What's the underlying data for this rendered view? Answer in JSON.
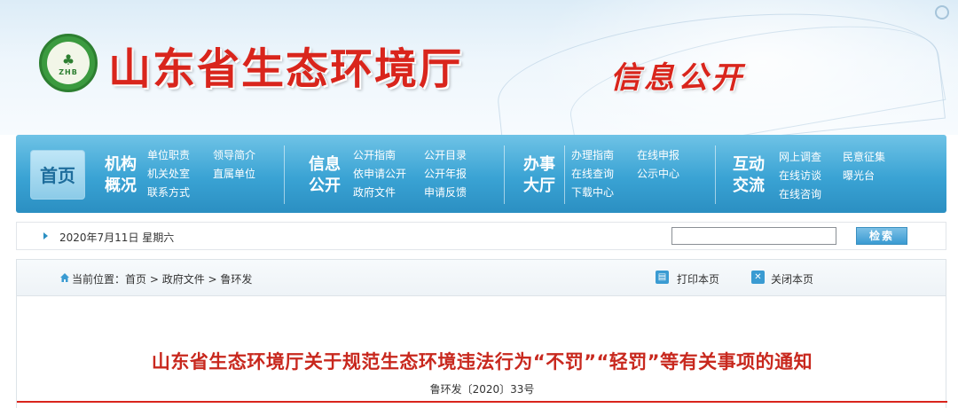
{
  "header": {
    "site_title": "山东省生态环境厅",
    "section_title": "信息公开",
    "logo_text": "ZHB"
  },
  "nav": {
    "home_label": "首页",
    "groups": [
      {
        "category": "机构概况",
        "cat_line1": "机构",
        "cat_line2": "概况",
        "links": [
          "单位职责",
          "领导简介",
          "机关处室",
          "直属单位",
          "联系方式"
        ]
      },
      {
        "category": "信息公开",
        "cat_line1": "信息",
        "cat_line2": "公开",
        "links": [
          "公开指南",
          "公开目录",
          "依申请公开",
          "公开年报",
          "政府文件",
          "申请反馈"
        ]
      },
      {
        "category": "办事大厅",
        "cat_line1": "办事",
        "cat_line2": "大厅",
        "links": [
          "办理指南",
          "在线申报",
          "在线查询",
          "公示中心",
          "下载中心"
        ]
      },
      {
        "category": "互动交流",
        "cat_line1": "互动",
        "cat_line2": "交流",
        "links": [
          "网上调查",
          "民意征集",
          "在线访谈",
          "曝光台",
          "在线咨询"
        ]
      }
    ]
  },
  "infobar": {
    "date": "2020年7月11日 星期六",
    "search_placeholder": "",
    "search_button": "检索"
  },
  "location": {
    "prefix": "当前位置：",
    "crumbs": [
      "首页",
      "政府文件",
      "鲁环发"
    ],
    "separator": " > ",
    "print_label": "打印本页",
    "close_label": "关闭本页"
  },
  "article": {
    "title": "山东省生态环境厅关于规范生态环境违法行为“不罚”“轻罚”等有关事项的通知",
    "doc_number": "鲁环发〔2020〕33号"
  },
  "colors": {
    "brand_red": "#d9251c",
    "nav_blue": "#3aa3d4",
    "title_red": "#c8281e"
  }
}
